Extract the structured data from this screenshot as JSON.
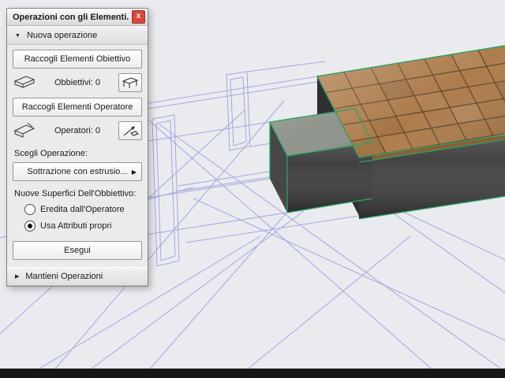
{
  "palette": {
    "title": "Operazioni con gli Elementi...",
    "close": "x",
    "section_new": "Nuova operazione",
    "section_keep": "Mantieni Operazioni",
    "collect_target": "Raccogli Elementi Obiettivo",
    "collect_operator": "Raccogli Elementi Operatore",
    "targets_count": "Obbiettivi: 0",
    "operators_count": "Operatori: 0",
    "choose_operation": "Scegli Operazione:",
    "operation_value": "Sottrazione con estrusio...",
    "new_surfaces": "Nuove Superfici Dell'Obbiettivo:",
    "radio_inherit": "Eredita dall'Operatore",
    "radio_inherit_selected": false,
    "radio_own": "Usa Attributi propri",
    "radio_own_selected": true,
    "execute": "Esegui",
    "icons": {
      "expanded": "▼",
      "collapsed": "▶",
      "menu_arrow": "▶"
    }
  },
  "scene": {
    "background": "#e9ebef",
    "wireframe_color": "#9a9ade",
    "highlight_color": "#2ba364",
    "tile_color": "#ad7c4c",
    "grout_color": "#5e4729",
    "tile_edge_color": "#8a5f37",
    "concrete_front": "#3e3e3e",
    "concrete_side": "#2f2f2f",
    "step_top": "#8f948c",
    "step_front": "#3a3a3a",
    "step_side": "#474747",
    "bottom_bar": "#161616"
  }
}
